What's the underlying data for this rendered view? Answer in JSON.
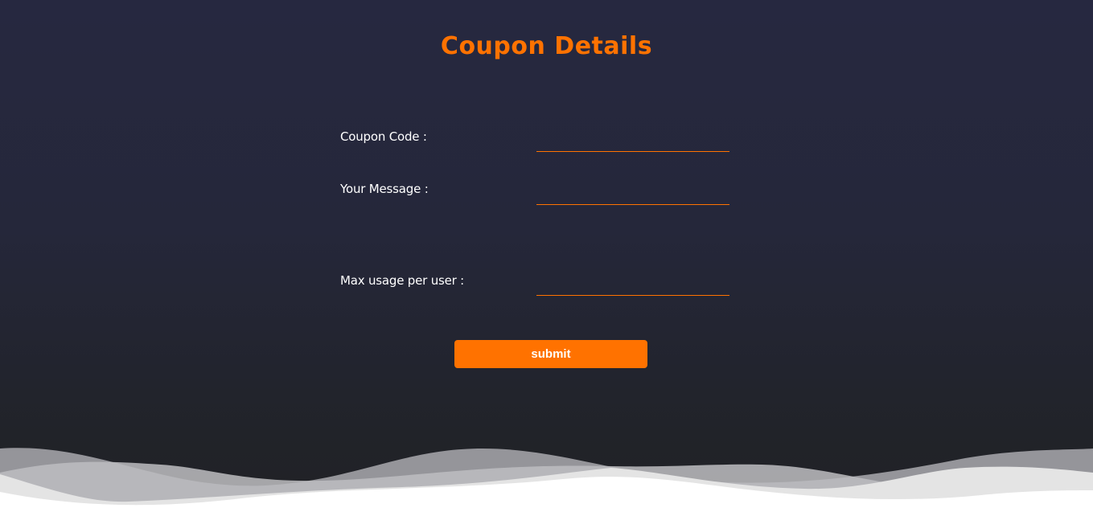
{
  "page": {
    "title": "Coupon Details"
  },
  "form": {
    "coupon_code": {
      "label": "Coupon Code :",
      "value": ""
    },
    "message": {
      "label": "Your Message :",
      "value": ""
    },
    "max_usage": {
      "label": "Max usage per user :",
      "value": ""
    },
    "submit_label": "submit"
  },
  "colors": {
    "accent": "#ff7200",
    "background": "#25273a",
    "text": "#ffffff"
  }
}
